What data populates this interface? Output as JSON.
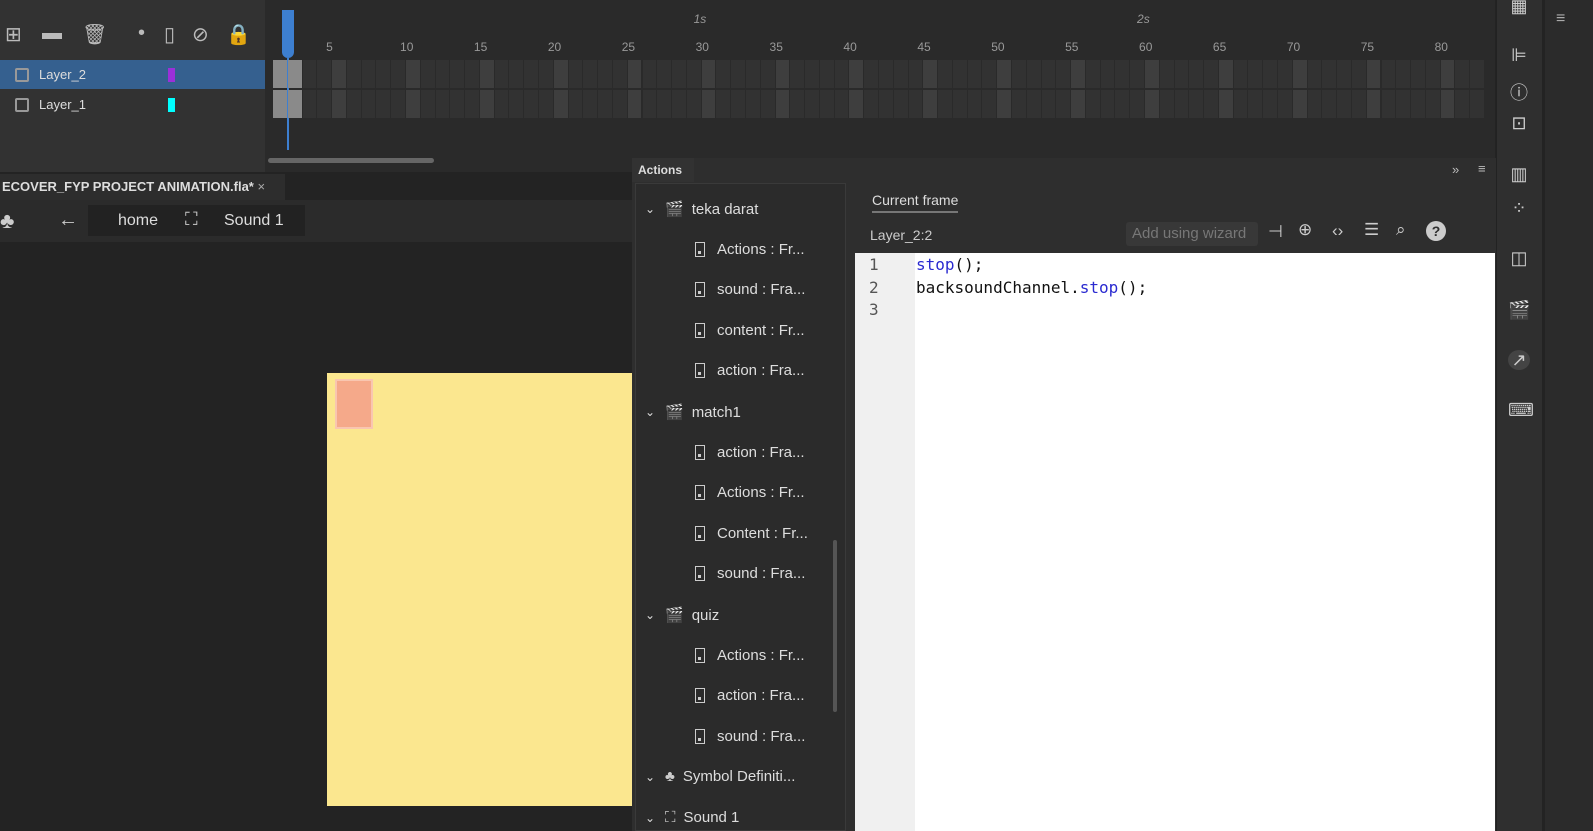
{
  "timeline": {
    "tools": [
      {
        "icon": "new-layer-icon",
        "glyph": "⊞"
      },
      {
        "icon": "folder-icon",
        "glyph": "▬"
      },
      {
        "icon": "trash-icon",
        "glyph": "🗑"
      },
      {
        "icon": "dot-icon",
        "glyph": "•"
      },
      {
        "icon": "outline-icon",
        "glyph": "▯"
      },
      {
        "icon": "hide-icon",
        "glyph": "⊘"
      },
      {
        "icon": "lock-icon",
        "glyph": "🔒"
      }
    ],
    "layers": [
      {
        "name": "Layer_2",
        "color": "#9b30d9",
        "selected": true
      },
      {
        "name": "Layer_1",
        "color": "#00ffff",
        "selected": false
      }
    ],
    "frame_numbers": [
      "5",
      "10",
      "15",
      "20",
      "25",
      "30",
      "35",
      "40",
      "45",
      "50",
      "55",
      "60",
      "65",
      "70",
      "75",
      "80"
    ],
    "seconds": [
      "1s",
      "2s"
    ],
    "current_frame": 2
  },
  "document": {
    "tab_title": "ECOVER_FYP PROJECT ANIMATION.fla*",
    "close": "×"
  },
  "breadcrumb": {
    "back": "←",
    "scene": "home",
    "symbol": "Sound 1"
  },
  "actions": {
    "tab": "Actions",
    "tree": [
      {
        "type": "scene",
        "label": "teka darat"
      },
      {
        "type": "frame",
        "label": "Actions : Fr..."
      },
      {
        "type": "frame",
        "label": "sound : Fra..."
      },
      {
        "type": "frame",
        "label": "content : Fr..."
      },
      {
        "type": "frame",
        "label": "action : Fra..."
      },
      {
        "type": "scene",
        "label": "match1"
      },
      {
        "type": "frame",
        "label": "action : Fra..."
      },
      {
        "type": "frame",
        "label": "Actions : Fr..."
      },
      {
        "type": "frame",
        "label": "Content : Fr..."
      },
      {
        "type": "frame",
        "label": "sound : Fra..."
      },
      {
        "type": "scene",
        "label": "quiz"
      },
      {
        "type": "frame",
        "label": "Actions : Fr..."
      },
      {
        "type": "frame",
        "label": "action : Fra..."
      },
      {
        "type": "frame",
        "label": "sound : Fra..."
      },
      {
        "type": "symbols",
        "label": "Symbol Definiti..."
      },
      {
        "type": "symbol",
        "label": "Sound 1"
      }
    ],
    "current_frame_tab": "Current frame",
    "location": "Layer_2:2",
    "wizard": "Add using wizard",
    "line_numbers": [
      "1",
      "2",
      "3"
    ],
    "code": {
      "l1_kw": "stop",
      "l1_rest": "();",
      "l2_obj": "backsoundChannel.",
      "l2_kw": "stop",
      "l2_rest": "();"
    }
  }
}
